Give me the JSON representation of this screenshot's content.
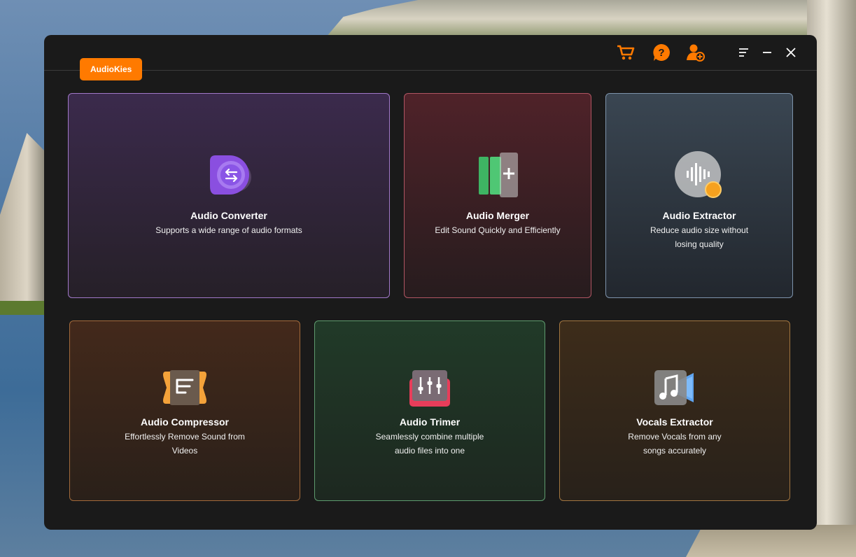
{
  "app": {
    "brand": "AudioKies"
  },
  "titlebar": {
    "icons": [
      "cart-icon",
      "help-icon",
      "user-add-icon",
      "menu-icon",
      "minimize-icon",
      "close-icon"
    ],
    "accent": "#ff7a00"
  },
  "cards": {
    "converter": {
      "title": "Audio Converter",
      "desc": "Supports a wide range of audio formats",
      "icon": "audio-converter-icon"
    },
    "merger": {
      "title": "Audio Merger",
      "desc": "Edit Sound Quickly and Efficiently",
      "icon": "audio-merger-icon"
    },
    "extractor": {
      "title": "Audio Extractor",
      "desc": "Reduce audio size without losing quality",
      "icon": "audio-extractor-icon"
    },
    "compressor": {
      "title": "Audio Compressor",
      "desc": "Effortlessly Remove Sound from Videos",
      "icon": "audio-compressor-icon"
    },
    "trimmer": {
      "title": "Audio Trimer",
      "desc": "Seamlessly combine multiple audio files into one",
      "icon": "audio-trimmer-icon"
    },
    "vocals": {
      "title": "Vocals Extractor",
      "desc": "Remove Vocals from any songs accurately",
      "icon": "vocals-extractor-icon"
    }
  }
}
